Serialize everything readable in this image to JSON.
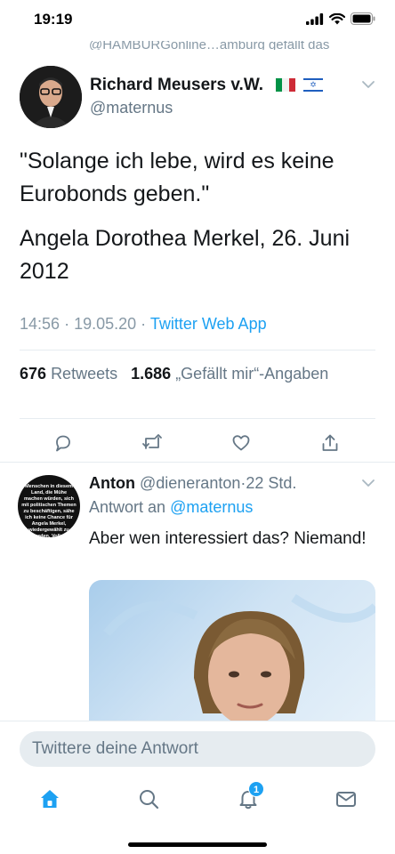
{
  "status_bar": {
    "time": "19:19"
  },
  "truncated_top_text": "@HAMBURGonline…amburg gefällt das",
  "tweet": {
    "author_name": "Richard Meusers v.W.",
    "author_handle": "@maternus",
    "flags": [
      "italy-flag",
      "israel-flag"
    ],
    "text_line1": "\"Solange ich lebe, wird es keine Eurobonds geben.\"",
    "text_line2": "Angela Dorothea Merkel, 26. Juni 2012",
    "time": "14:56",
    "date": "19.05.20",
    "sep": "·",
    "source": "Twitter Web App",
    "retweets_count": "676",
    "retweets_label": "Retweets",
    "likes_count": "1.686",
    "likes_label": "„Gefällt mir“-Angaben"
  },
  "reply": {
    "author_name": "Anton",
    "author_handle": "@dieneranton",
    "sep": "·",
    "age": "22 Std.",
    "reply_prefix": "Antwort an",
    "reply_mention": "@maternus",
    "text": "Aber wen interessiert das? Niemand!",
    "avatar_text": "Menschen in diesem Land, die Mühe machen würden, sich mit politischen Themen zu beschäftigen, sähe ich keine Chance für Angela Merkel, wiedergewählt zu werden. Volker"
  },
  "compose": {
    "placeholder": "Twittere deine Antwort"
  },
  "tabbar": {
    "notifications_badge": "1"
  },
  "colors": {
    "accent": "#1da1f2",
    "secondary_text": "#657786",
    "divider": "#e6ecf0"
  }
}
